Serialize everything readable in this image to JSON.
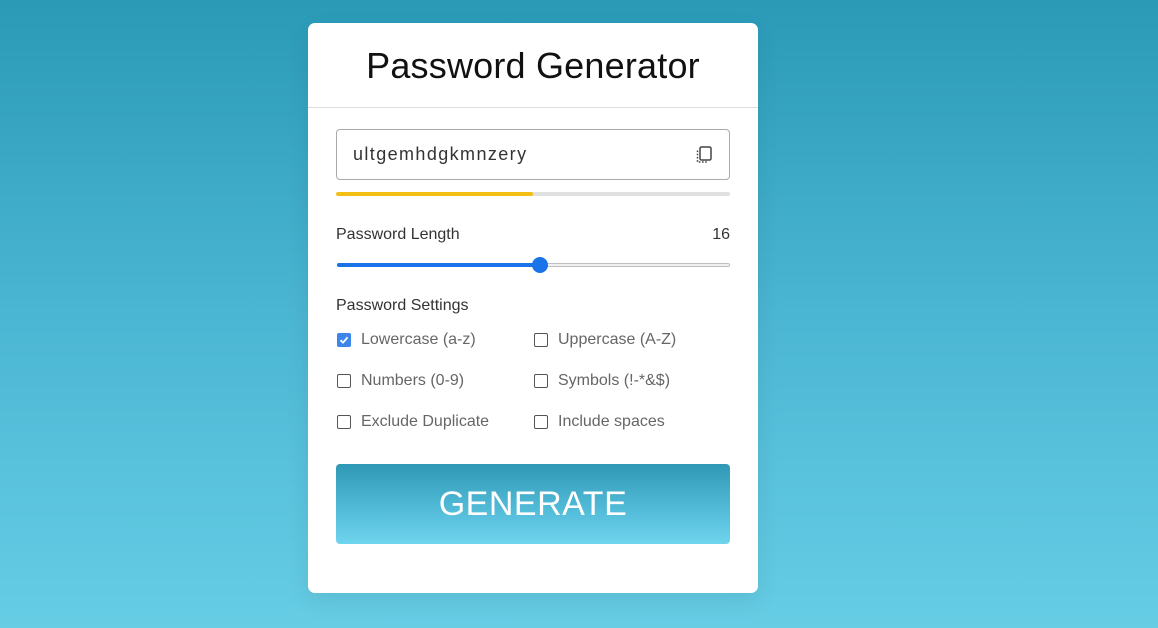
{
  "app": {
    "title": "Password Generator"
  },
  "password": {
    "value": "ultgemhdgkmnzery",
    "strength_fraction": 0.5,
    "strength_color": "#f2c012"
  },
  "length": {
    "label": "Password Length",
    "value": "16",
    "min": 1,
    "max": 30
  },
  "settings": {
    "title": "Password Settings",
    "options": [
      {
        "label": "Lowercase (a-z)",
        "checked": true
      },
      {
        "label": "Uppercase (A-Z)",
        "checked": false
      },
      {
        "label": "Numbers (0-9)",
        "checked": false
      },
      {
        "label": "Symbols (!-*&$)",
        "checked": false
      },
      {
        "label": "Exclude Duplicate",
        "checked": false
      },
      {
        "label": "Include spaces",
        "checked": false
      }
    ]
  },
  "actions": {
    "generate_label": "GENERATE"
  },
  "icons": {
    "copy": "copy-icon",
    "check": "check-icon"
  },
  "colors": {
    "accent": "#1a73e8",
    "checkbox_checked": "#3b86e8"
  }
}
